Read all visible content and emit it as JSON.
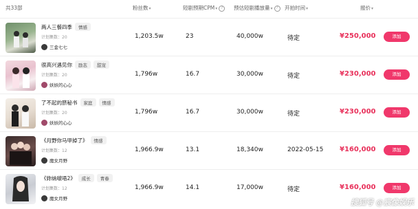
{
  "header": {
    "total": "共33部",
    "col_fans": "粉丝数",
    "col_cpm": "短剧预期CPM",
    "col_plays": "预估短剧播放量",
    "col_date": "开拍时间",
    "col_price": "报价"
  },
  "rows": [
    {
      "title": "两人三餐四季",
      "tags": [
        "情感"
      ],
      "sub": "计划集数：20",
      "author": "三金七七",
      "fans": "1,203.5w",
      "cpm": "23",
      "plays": "40,000w",
      "date": "待定",
      "price": "¥250,000",
      "btn": "添加"
    },
    {
      "title": "很高兴遇见你",
      "tags": [
        "励志",
        "甜宠"
      ],
      "sub": "计划集数：20",
      "author": "妖妖的心心",
      "fans": "1,796w",
      "cpm": "16.7",
      "plays": "30,000w",
      "date": "待定",
      "price": "¥230,000",
      "btn": "添加"
    },
    {
      "title": "了不起的脐秘书",
      "tags": [
        "家庭",
        "情感"
      ],
      "sub": "计划集数：20",
      "author": "妖妖的心心",
      "fans": "1,796w",
      "cpm": "16.7",
      "plays": "30,000w",
      "date": "待定",
      "price": "¥230,000",
      "btn": "添加"
    },
    {
      "title": "《月野你马甲掉了》",
      "tags": [
        "情感"
      ],
      "sub": "计划集数：12",
      "author": "魔女月野",
      "fans": "1,966.9w",
      "cpm": "13.1",
      "plays": "18,340w",
      "date": "2022-05-15",
      "price": "¥160,000",
      "btn": "添加"
    },
    {
      "title": "《妳纳啵唔2》",
      "tags": [
        "成长",
        "青春"
      ],
      "sub": "计划集数：12",
      "author": "魔女月野",
      "fans": "1,966.9w",
      "cpm": "14.1",
      "plays": "17,000w",
      "date": "待定",
      "price": "¥160,000",
      "btn": "添加"
    }
  ],
  "watermark": "搜狐号 @宸像娱乐",
  "colors": {
    "accent": "#f0386b",
    "price": "#e8315b"
  }
}
